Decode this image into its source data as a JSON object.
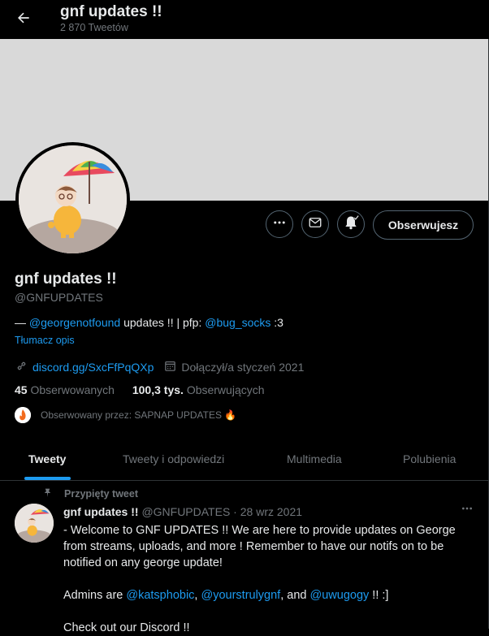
{
  "header": {
    "title": "gnf updates !!",
    "tweet_count": "2 870 Tweetów"
  },
  "profile": {
    "name": "gnf updates !!",
    "handle": "@GNFUPDATES",
    "bio": {
      "prefix": "— ",
      "mention1": "@georgenotfound",
      "middle": " updates !! | pfp: ",
      "mention2": "@bug_socks",
      "suffix": " :3"
    },
    "translate_label": "Tłumacz opis",
    "link": "discord.gg/SxcFfPqQXp",
    "joined": "Dołączył/a styczeń 2021",
    "following_count": "45",
    "following_label": "Obserwowanych",
    "followers_count": "100,3 tys.",
    "followers_label": "Obserwujących",
    "followed_by": "Obserwowany przez: SAPNAP UPDATES 🔥",
    "follow_button": "Obserwujesz"
  },
  "tabs": [
    {
      "label": "Tweety",
      "active": true
    },
    {
      "label": "Tweety i odpowiedzi",
      "active": false
    },
    {
      "label": "Multimedia",
      "active": false
    },
    {
      "label": "Polubienia",
      "active": false
    }
  ],
  "pinned_tweet": {
    "pinned_label": "Przypięty tweet",
    "author_name": "gnf updates !!",
    "author_handle": "@GNFUPDATES",
    "separator": " · ",
    "date": "28 wrz 2021",
    "line1": "- Welcome to GNF UPDATES !! We are here to provide updates on George from streams, uploads, and more ! Remember to have our notifs on to be notified on any george update!",
    "admins_prefix": "Admins are ",
    "admin1": "@katsphobic",
    "sep1": ", ",
    "admin2": "@yourstrulygnf",
    "sep2": ", and ",
    "admin3": "@uwugogy",
    "admins_suffix": " !! :]",
    "line3": "Check out our Discord !!"
  },
  "colors": {
    "background": "#000000",
    "accent": "#1d9bf0",
    "text_primary": "#e7e9ea",
    "text_secondary": "#71767b",
    "banner": "#d9d9d9"
  },
  "icons": [
    "back-arrow-icon",
    "more-icon",
    "message-icon",
    "notification-bell-icon",
    "link-icon",
    "calendar-icon",
    "pin-icon"
  ]
}
